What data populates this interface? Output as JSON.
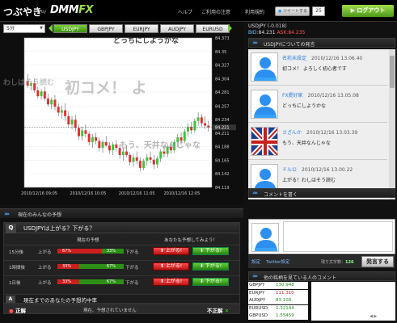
{
  "header": {
    "logo_main": "つぶやき",
    "logo_by": "by",
    "logo_brand": "DMM",
    "logo_fx": "FX",
    "links": [
      "ヘルプ",
      "ご利用の注意",
      "利用規約"
    ],
    "tweet_label": "ツイートする",
    "tweet_count": "25",
    "logout_label": "ログアウト"
  },
  "chart_panel": {
    "timeframe": "5分",
    "pairs": [
      "USDJPY",
      "GBPJPY",
      "EURJPY",
      "AUDJPY",
      "EURUSD"
    ],
    "active_pair": "USDJPY",
    "overlay_comments": [
      "どっちにしようかな",
      "わしはそう読む",
      "初コメ！ よ",
      "もう、天井なんじゃな"
    ]
  },
  "chart_data": {
    "type": "candlestick",
    "y_ticks": [
      84.119,
      84.142,
      84.165,
      84.188,
      84.211,
      84.234,
      84.257,
      84.281,
      84.304,
      84.327,
      84.35,
      84.373
    ],
    "ylim": [
      84.119,
      84.373
    ],
    "x_tick_labels": [
      "2010/12/16 09:05",
      "2010/12/16 10:05",
      "2010/12/16 11:05",
      "2010/12/16 12:05"
    ],
    "current_price": "84.221",
    "candles": [
      {
        "o": 84.3,
        "h": 84.312,
        "l": 84.288,
        "c": 84.292
      },
      {
        "o": 84.292,
        "h": 84.3,
        "l": 84.284,
        "c": 84.296
      },
      {
        "o": 84.296,
        "h": 84.304,
        "l": 84.28,
        "c": 84.284
      },
      {
        "o": 84.284,
        "h": 84.29,
        "l": 84.27,
        "c": 84.274
      },
      {
        "o": 84.274,
        "h": 84.286,
        "l": 84.268,
        "c": 84.282
      },
      {
        "o": 84.282,
        "h": 84.29,
        "l": 84.266,
        "c": 84.27
      },
      {
        "o": 84.27,
        "h": 84.278,
        "l": 84.256,
        "c": 84.26
      },
      {
        "o": 84.26,
        "h": 84.272,
        "l": 84.252,
        "c": 84.268
      },
      {
        "o": 84.268,
        "h": 84.276,
        "l": 84.25,
        "c": 84.256
      },
      {
        "o": 84.256,
        "h": 84.262,
        "l": 84.24,
        "c": 84.246
      },
      {
        "o": 84.246,
        "h": 84.258,
        "l": 84.236,
        "c": 84.25
      },
      {
        "o": 84.25,
        "h": 84.262,
        "l": 84.232,
        "c": 84.24
      },
      {
        "o": 84.24,
        "h": 84.248,
        "l": 84.22,
        "c": 84.226
      },
      {
        "o": 84.226,
        "h": 84.24,
        "l": 84.218,
        "c": 84.234
      },
      {
        "o": 84.234,
        "h": 84.242,
        "l": 84.214,
        "c": 84.22
      },
      {
        "o": 84.22,
        "h": 84.226,
        "l": 84.2,
        "c": 84.206
      },
      {
        "o": 84.206,
        "h": 84.222,
        "l": 84.198,
        "c": 84.216
      },
      {
        "o": 84.216,
        "h": 84.226,
        "l": 84.204,
        "c": 84.21
      },
      {
        "o": 84.21,
        "h": 84.214,
        "l": 84.19,
        "c": 84.196
      },
      {
        "o": 84.196,
        "h": 84.21,
        "l": 84.186,
        "c": 84.204
      },
      {
        "o": 84.204,
        "h": 84.212,
        "l": 84.192,
        "c": 84.198
      },
      {
        "o": 84.198,
        "h": 84.204,
        "l": 84.18,
        "c": 84.186
      },
      {
        "o": 84.186,
        "h": 84.2,
        "l": 84.178,
        "c": 84.196
      },
      {
        "o": 84.196,
        "h": 84.206,
        "l": 84.188,
        "c": 84.19
      },
      {
        "o": 84.19,
        "h": 84.196,
        "l": 84.176,
        "c": 84.182
      },
      {
        "o": 84.182,
        "h": 84.196,
        "l": 84.174,
        "c": 84.192
      },
      {
        "o": 84.192,
        "h": 84.2,
        "l": 84.18,
        "c": 84.186
      },
      {
        "o": 84.186,
        "h": 84.192,
        "l": 84.168,
        "c": 84.174
      },
      {
        "o": 84.174,
        "h": 84.186,
        "l": 84.164,
        "c": 84.18
      },
      {
        "o": 84.18,
        "h": 84.19,
        "l": 84.17,
        "c": 84.174
      },
      {
        "o": 84.174,
        "h": 84.178,
        "l": 84.156,
        "c": 84.162
      },
      {
        "o": 84.162,
        "h": 84.176,
        "l": 84.154,
        "c": 84.17
      },
      {
        "o": 84.17,
        "h": 84.18,
        "l": 84.158,
        "c": 84.164
      },
      {
        "o": 84.164,
        "h": 84.17,
        "l": 84.146,
        "c": 84.152
      },
      {
        "o": 84.152,
        "h": 84.168,
        "l": 84.148,
        "c": 84.164
      },
      {
        "o": 84.164,
        "h": 84.176,
        "l": 84.156,
        "c": 84.17
      },
      {
        "o": 84.17,
        "h": 84.18,
        "l": 84.16,
        "c": 84.166
      },
      {
        "o": 84.166,
        "h": 84.174,
        "l": 84.15,
        "c": 84.158
      },
      {
        "o": 84.158,
        "h": 84.172,
        "l": 84.152,
        "c": 84.168
      },
      {
        "o": 84.168,
        "h": 84.184,
        "l": 84.162,
        "c": 84.18
      },
      {
        "o": 84.18,
        "h": 84.19,
        "l": 84.17,
        "c": 84.176
      },
      {
        "o": 84.176,
        "h": 84.192,
        "l": 84.17,
        "c": 84.188
      },
      {
        "o": 84.188,
        "h": 84.196,
        "l": 84.176,
        "c": 84.182
      },
      {
        "o": 84.182,
        "h": 84.2,
        "l": 84.178,
        "c": 84.196
      },
      {
        "o": 84.196,
        "h": 84.21,
        "l": 84.188,
        "c": 84.204
      },
      {
        "o": 84.204,
        "h": 84.212,
        "l": 84.192,
        "c": 84.198
      },
      {
        "o": 84.198,
        "h": 84.218,
        "l": 84.194,
        "c": 84.214
      },
      {
        "o": 84.214,
        "h": 84.228,
        "l": 84.206,
        "c": 84.222
      },
      {
        "o": 84.222,
        "h": 84.23,
        "l": 84.21,
        "c": 84.216
      },
      {
        "o": 84.216,
        "h": 84.236,
        "l": 84.212,
        "c": 84.232
      },
      {
        "o": 84.232,
        "h": 84.246,
        "l": 84.224,
        "c": 84.238
      },
      {
        "o": 84.238,
        "h": 84.244,
        "l": 84.222,
        "c": 84.228
      },
      {
        "o": 84.228,
        "h": 84.24,
        "l": 84.218,
        "c": 84.224
      },
      {
        "o": 84.224,
        "h": 84.232,
        "l": 84.214,
        "c": 84.221
      }
    ],
    "colors": {
      "up": "#3bc43b",
      "down": "#e03030",
      "bg": "#ffffff",
      "grid": "#cccccc"
    }
  },
  "sentiment": {
    "section_title": "現在のみんなの予想",
    "q_mark": "Q",
    "question": "USDJPYは上がる？下がる？",
    "col_forecast": "現在の予想",
    "col_you": "あなたも予想してみよう！",
    "up_word": "上がる",
    "down_word": "下がる",
    "up_button": "上がる!",
    "down_button": "下がる!",
    "rows": [
      {
        "label": "15分後",
        "up_pct": 67,
        "down_pct": 33,
        "up_text": "67%",
        "down_text": "33%"
      },
      {
        "label": "1時間後",
        "up_pct": 33,
        "down_pct": 67,
        "up_text": "33%",
        "down_text": "67%"
      },
      {
        "label": "1日後",
        "up_pct": 33,
        "down_pct": 67,
        "up_text": "33%",
        "down_text": "67%"
      }
    ],
    "a_mark": "A",
    "accuracy_title": "現在までのあなたの予想的中率",
    "correct_label": "正解",
    "status_text": "現在、予想されていません",
    "incorrect_label": "不正解"
  },
  "right_panel": {
    "pair_line": "USDJPY",
    "change": "(-0.018)",
    "bid_label": "BID:",
    "bid": "84.231",
    "ask_label": "ASK:",
    "ask": "84.235",
    "feed_title": "USDJPYについての発言",
    "posts": [
      {
        "name": "名前未設定",
        "time": "2010/12/16 13.06.40",
        "msg": "初コメ！ よろしく初心者です",
        "avatar": "silhouette"
      },
      {
        "name": "FX愛好家",
        "time": "2010/12/16 13.05.08",
        "msg": "どっちにしようかな",
        "avatar": "silhouette"
      },
      {
        "name": "さざんか",
        "time": "2010/12/16 13.03.39",
        "msg": "もう、天井なんじゃな",
        "avatar": "uk-flag"
      },
      {
        "name": "ドル公",
        "time": "2010/12/16 13.00.22",
        "msg": "上がる！わしはそう読む",
        "avatar": "silhouette"
      }
    ],
    "composer_title": "コメントを書く",
    "settings_label": "設定",
    "twitter_label": "Twitter設定",
    "remaining_label": "残り文字数：",
    "remaining_count": "126",
    "post_button": "発言する",
    "others_title": "他の銘柄を見ている人のコメント",
    "rates": [
      {
        "pair": "GBPJPY",
        "value": "130.948",
        "dir": "up"
      },
      {
        "pair": "EURJPY",
        "value": "111.310",
        "dir": "dn"
      },
      {
        "pair": "AUDJPY",
        "value": "83.109",
        "dir": "up"
      },
      {
        "pair": "EURUSD",
        "value": "1.32144",
        "dir": "up"
      },
      {
        "pair": "GBPUSD",
        "value": "1.55459",
        "dir": "up"
      }
    ],
    "pager": "◀ ▶"
  }
}
